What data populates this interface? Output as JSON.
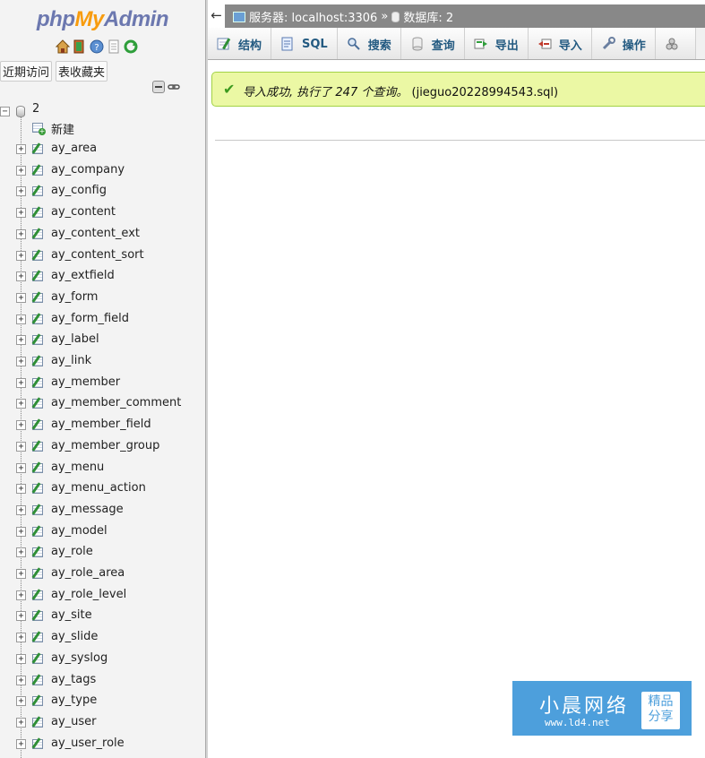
{
  "logo": {
    "part1": "php",
    "part2": "My",
    "part3": "Admin"
  },
  "nav": {
    "icons": [
      "home-icon",
      "exit-icon",
      "help-icon",
      "docs-icon",
      "reload-icon"
    ],
    "links": {
      "recent": "近期访问",
      "favorites": "表收藏夹"
    }
  },
  "tree": {
    "database": "2",
    "new_label": "新建",
    "tables": [
      "ay_area",
      "ay_company",
      "ay_config",
      "ay_content",
      "ay_content_ext",
      "ay_content_sort",
      "ay_extfield",
      "ay_form",
      "ay_form_field",
      "ay_label",
      "ay_link",
      "ay_member",
      "ay_member_comment",
      "ay_member_field",
      "ay_member_group",
      "ay_menu",
      "ay_menu_action",
      "ay_message",
      "ay_model",
      "ay_role",
      "ay_role_area",
      "ay_role_level",
      "ay_site",
      "ay_slide",
      "ay_syslog",
      "ay_tags",
      "ay_type",
      "ay_user",
      "ay_user_role"
    ]
  },
  "topbar": {
    "back": "←",
    "server": "服务器: localhost:3306",
    "sep": "»",
    "database": "数据库: 2"
  },
  "tabs": [
    {
      "label": "结构",
      "icon": "structure-icon"
    },
    {
      "label": "SQL",
      "icon": "sql-icon"
    },
    {
      "label": "搜索",
      "icon": "search-icon"
    },
    {
      "label": "查询",
      "icon": "query-icon"
    },
    {
      "label": "导出",
      "icon": "export-icon"
    },
    {
      "label": "导入",
      "icon": "import-icon"
    },
    {
      "label": "操作",
      "icon": "wrench-icon"
    },
    {
      "label": "",
      "icon": "more-icon"
    }
  ],
  "message": {
    "prefix": "导入成功, 执行了 ",
    "count": "247",
    "middle": " 个查询。",
    "file": "(jieguo20228994543.sql)"
  },
  "watermark": {
    "title": "小晨网络",
    "url": "www.ld4.net",
    "badge_line1": "精品",
    "badge_line2": "分享"
  }
}
